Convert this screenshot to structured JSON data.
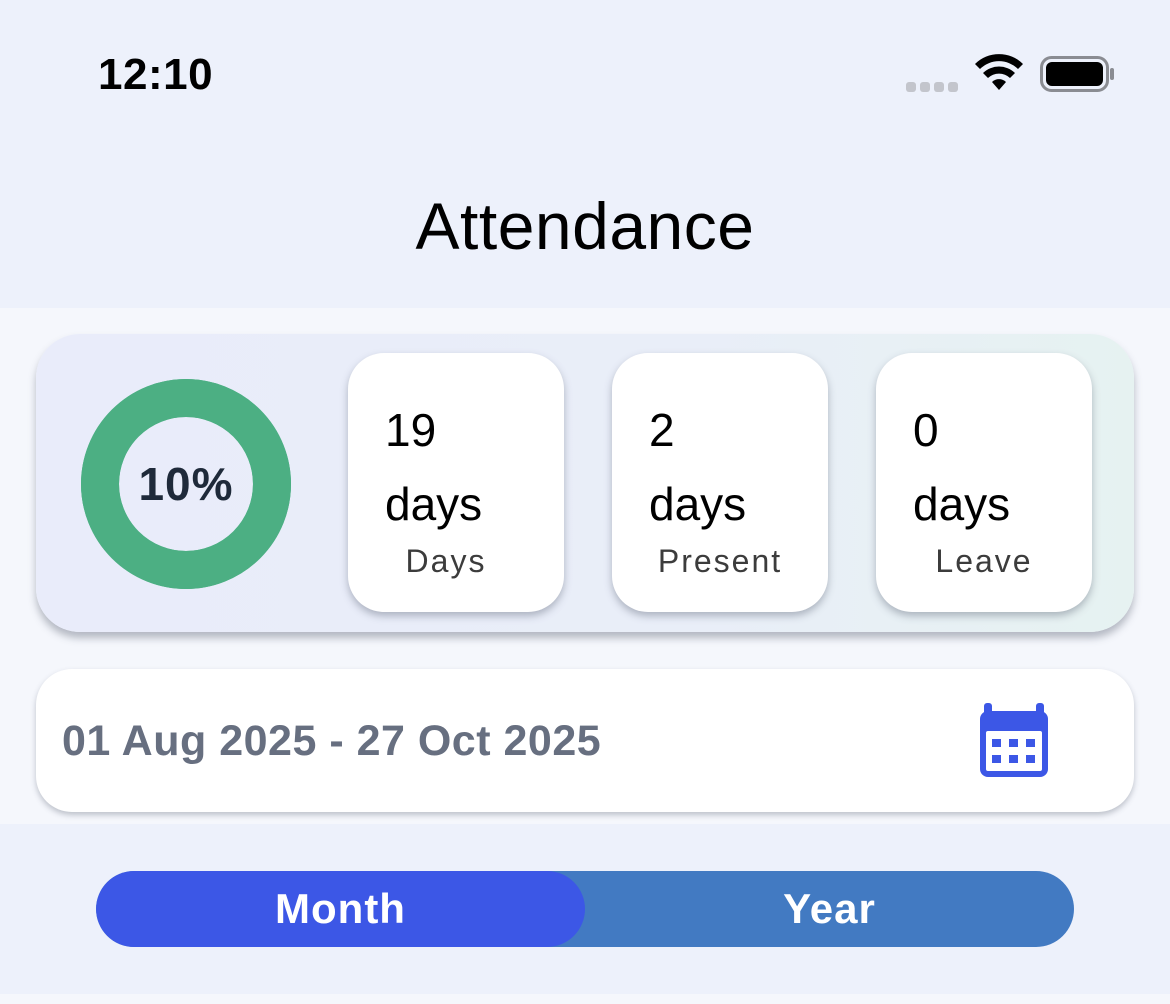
{
  "status_bar": {
    "time": "12:10",
    "icons": [
      "signal-icon",
      "wifi-icon",
      "battery-icon"
    ]
  },
  "header": {
    "title": "Attendance"
  },
  "summary": {
    "attendance_percent_label": "10%",
    "attendance_fraction": 0.1,
    "ring_color": "#4caf83",
    "stats": [
      {
        "value": "19\ndays",
        "label": "Days"
      },
      {
        "value": "2\ndays",
        "label": "Present"
      },
      {
        "value": "0\ndays",
        "label": "Leave"
      }
    ]
  },
  "date_range": {
    "text": "01 Aug 2025 - 27 Oct 2025",
    "icon": "calendar-icon",
    "icon_color": "#3c57e6"
  },
  "period_toggle": {
    "options": [
      "Month",
      "Year"
    ],
    "selected": "Month",
    "active_color": "#3c57e6",
    "inactive_color": "#427ac2"
  }
}
